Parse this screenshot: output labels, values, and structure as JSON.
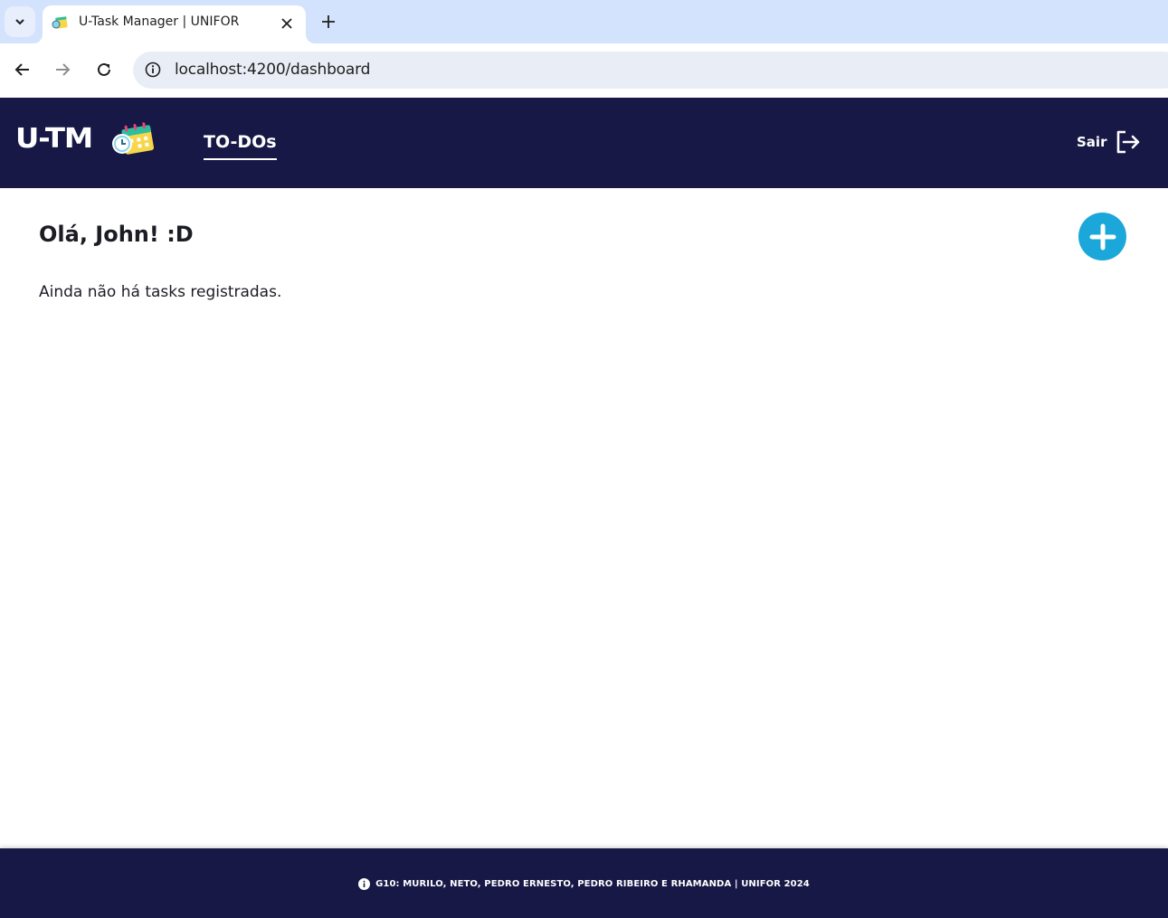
{
  "browser": {
    "tab_title": "U-Task Manager | UNIFOR",
    "url": "localhost:4200/dashboard"
  },
  "header": {
    "brand": "U-TM",
    "nav_link": "TO-DOs",
    "logout_label": "Sair"
  },
  "main": {
    "greeting": "Olá, John! :D",
    "empty_message": "Ainda não há tasks registradas."
  },
  "footer": {
    "text": "G10: MURILO, NETO, PEDRO ERNESTO, PEDRO RIBEIRO E RHAMANDA |  UNIFOR 2024"
  },
  "colors": {
    "header_bg": "#171846",
    "accent": "#1ba7d9",
    "tabstrip_bg": "#d3e3fd"
  }
}
